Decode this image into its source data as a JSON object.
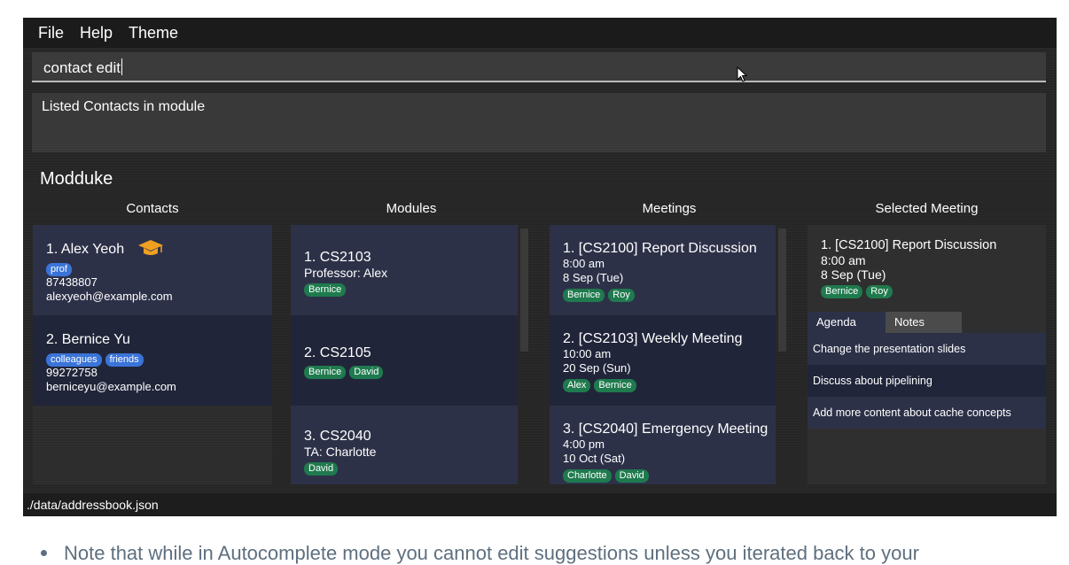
{
  "menu": {
    "file": "File",
    "help": "Help",
    "theme": "Theme"
  },
  "command": {
    "value": "contact edit"
  },
  "result": {
    "text": "Listed Contacts in module"
  },
  "app_title": "Modduke",
  "columns": {
    "contacts": "Contacts",
    "modules": "Modules",
    "meetings": "Meetings",
    "selected": "Selected Meeting"
  },
  "contacts": [
    {
      "title": "1.  Alex Yeoh",
      "tags": [
        "prof"
      ],
      "phone": "87438807",
      "email": "alexyeoh@example.com",
      "icon": "graduation-cap-icon"
    },
    {
      "title": "2.  Bernice Yu",
      "tags": [
        "colleagues",
        "friends"
      ],
      "phone": "99272758",
      "email": "berniceyu@example.com"
    }
  ],
  "modules": [
    {
      "title": "1.  CS2103",
      "detail": "Professor: Alex",
      "tags": [
        "Bernice"
      ]
    },
    {
      "title": "2.  CS2105",
      "detail": "",
      "tags": [
        "Bernice",
        "David"
      ]
    },
    {
      "title": "3.  CS2040",
      "detail": "TA: Charlotte",
      "tags": [
        "David"
      ]
    }
  ],
  "meetings": [
    {
      "title": "1.  [CS2100] Report Discussion",
      "time": "8:00 am",
      "date": "8 Sep (Tue)",
      "tags": [
        "Bernice",
        "Roy"
      ]
    },
    {
      "title": "2.  [CS2103] Weekly Meeting",
      "time": "10:00 am",
      "date": "20 Sep (Sun)",
      "tags": [
        "Alex",
        "Bernice"
      ]
    },
    {
      "title": "3.  [CS2040] Emergency Meeting",
      "time": "4:00 pm",
      "date": "10 Oct (Sat)",
      "tags": [
        "Charlotte",
        "David"
      ]
    }
  ],
  "selected": {
    "title": "1.  [CS2100] Report Discussion",
    "time": "8:00 am",
    "date": "8 Sep (Tue)",
    "tags": [
      "Bernice",
      "Roy"
    ],
    "tabs": {
      "agenda": "Agenda",
      "notes": "Notes"
    },
    "agenda": [
      "Change the presentation slides",
      "Discuss about pipelining",
      "Add more content about cache concepts"
    ]
  },
  "status": {
    "path": "./data/addressbook.json"
  },
  "note": {
    "text": "Note that while in Autocomplete mode you cannot edit suggestions unless you iterated back to your"
  },
  "colors": {
    "card_odd": "#2d3148",
    "card_even": "#21253a",
    "tag_green": "#1f7a4e",
    "tag_blue": "#3a74d8"
  }
}
